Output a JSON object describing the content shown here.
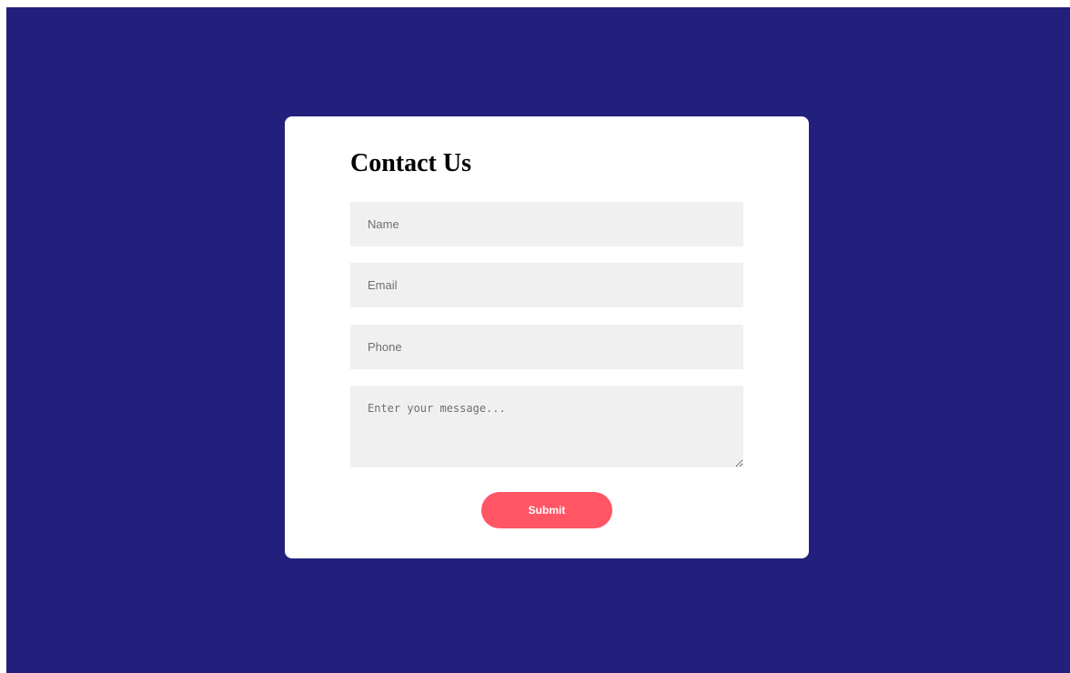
{
  "contact_form": {
    "title": "Contact Us",
    "name_placeholder": "Name",
    "email_placeholder": "Email",
    "phone_placeholder": "Phone",
    "message_placeholder": "Enter your message...",
    "submit_label": "Submit"
  },
  "colors": {
    "background": "#22207c",
    "card": "#ffffff",
    "field": "#f0f0f0",
    "accent": "#ff5565"
  }
}
